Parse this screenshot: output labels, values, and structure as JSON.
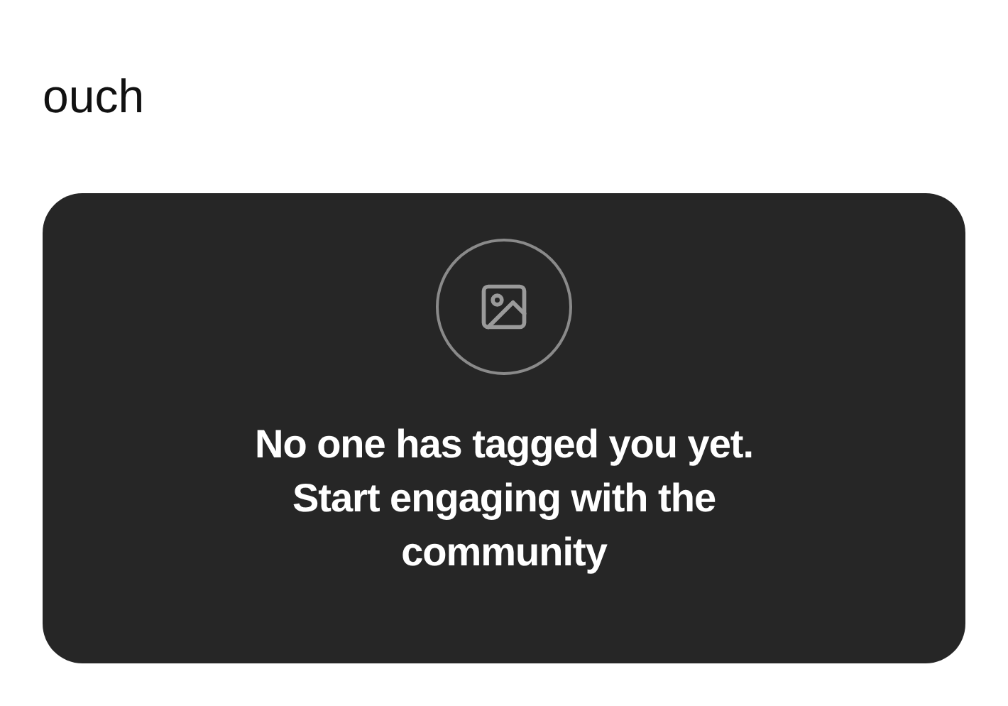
{
  "caption": "ouch",
  "card": {
    "message": "No one has tagged you yet. Start engaging with the community"
  }
}
